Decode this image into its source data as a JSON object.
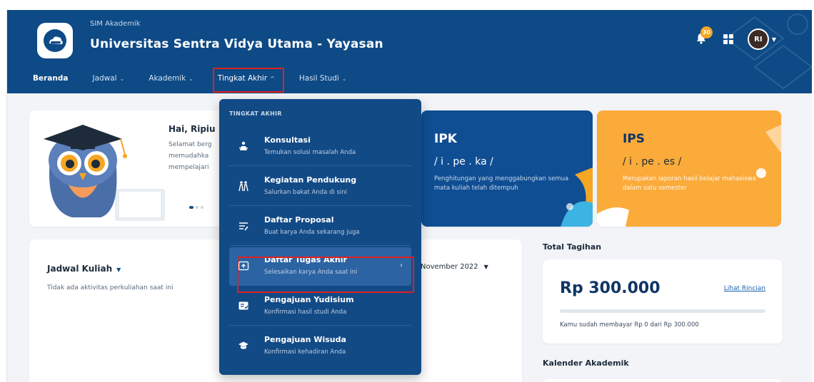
{
  "header": {
    "subtitle": "SIM Akademik",
    "title": "Universitas Sentra Vidya Utama - Yayasan",
    "notification_count": "30",
    "avatar_initials": "RI"
  },
  "nav": {
    "items": [
      {
        "label": "Beranda"
      },
      {
        "label": "Jadwal"
      },
      {
        "label": "Akademik"
      },
      {
        "label": "Tingkat Akhir"
      },
      {
        "label": "Hasil Studi"
      }
    ]
  },
  "dropdown": {
    "header": "TINGKAT AKHIR",
    "items": [
      {
        "title": "Konsultasi",
        "subtitle": "Temukan solusi masalah Anda",
        "icon": "consultation-icon"
      },
      {
        "title": "Kegiatan Pendukung",
        "subtitle": "Salurkan bakat Anda di sini",
        "icon": "activity-icon"
      },
      {
        "title": "Daftar Proposal",
        "subtitle": "Buat karya Anda sekarang juga",
        "icon": "proposal-icon"
      },
      {
        "title": "Daftar Tugas Akhir",
        "subtitle": "Selesaikan karya Anda saat ini",
        "icon": "thesis-icon"
      },
      {
        "title": "Pengajuan Yudisium",
        "subtitle": "Konfirmasi hasil studi Anda",
        "icon": "yudisium-icon"
      },
      {
        "title": "Pengajuan Wisuda",
        "subtitle": "Konfirmasi kehadiran Anda",
        "icon": "graduation-cap-icon"
      }
    ]
  },
  "welcome": {
    "greeting": "Hai, Ripiu",
    "lines": [
      "Selamat berg",
      "memudahka",
      "mempelajari"
    ]
  },
  "ipk": {
    "title": "IPK",
    "phonetic": "/ i . pe . ka /",
    "description": "Penghitungan yang menggabungkan semua mata kuliah telah ditempuh"
  },
  "ips": {
    "title": "IPS",
    "phonetic": "/ i . pe . es /",
    "description": "Merupakan laporan hasil belajar mahasiswa dalam satu semester"
  },
  "jadwal": {
    "title": "Jadwal Kuliah",
    "empty": "Tidak ada aktivitas perkuliahan saat ini",
    "month": "November 2022"
  },
  "tagihan": {
    "label": "Total Tagihan",
    "amount": "Rp 300.000",
    "link": "Lihat Rincian",
    "paid_fraction": 0,
    "note": "Kamu sudah membayar Rp 0 dari Rp 300.000"
  },
  "kalender": {
    "label": "Kalender Akademik"
  },
  "colors": {
    "primary": "#0d4a86",
    "accent": "#fbab3a",
    "highlight": "#e02020"
  }
}
